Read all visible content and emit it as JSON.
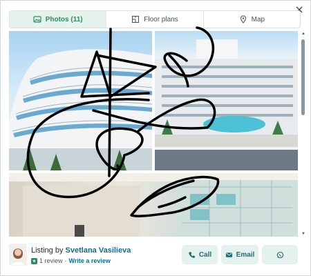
{
  "tabs": [
    {
      "label": "Photos (11)",
      "icon": "photo-icon",
      "active": true
    },
    {
      "label": "Floor plans",
      "icon": "floor-plan-icon",
      "active": false
    },
    {
      "label": "Map",
      "icon": "map-pin-icon",
      "active": false
    }
  ],
  "footer": {
    "listing_prefix": "Listing by",
    "agent_name": "Svetlana Vasilieva",
    "review_count": "1 review",
    "separator": "·",
    "write_review": "Write a review",
    "buttons": {
      "call": "Call",
      "email": "Email"
    }
  },
  "colors": {
    "accent": "#2e8a5f",
    "link": "#0f6c8f",
    "button_bg": "#e3f1ef",
    "button_text": "#1e6f6d"
  }
}
